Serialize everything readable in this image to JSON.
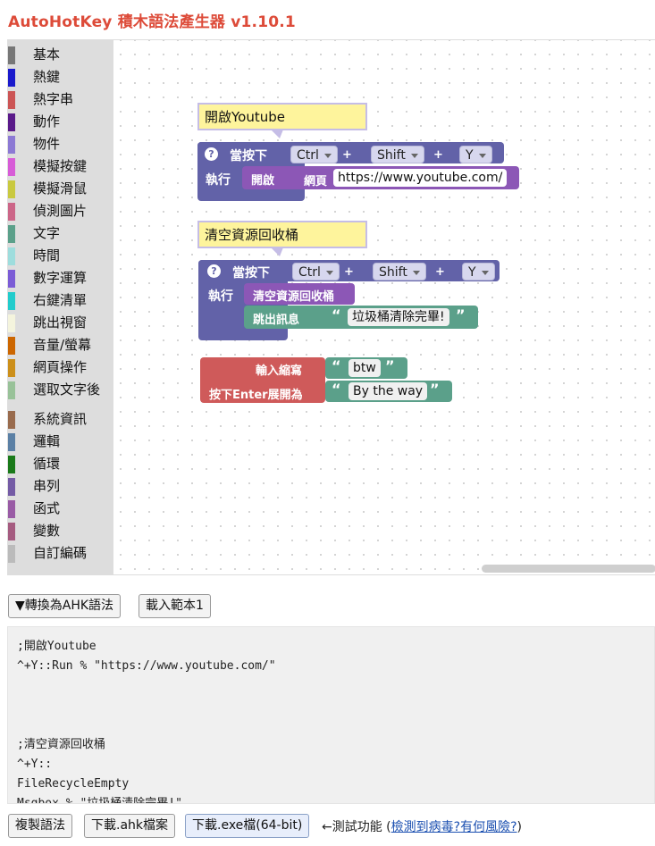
{
  "app": {
    "title": "AutoHotKey 積木語法產生器 v1.10.1"
  },
  "toolbox": {
    "categories": [
      {
        "label": "基本",
        "color": "#777777"
      },
      {
        "label": "熱鍵",
        "color": "#1a1acc"
      },
      {
        "label": "熱字串",
        "color": "#cc5555"
      },
      {
        "label": "動作",
        "color": "#5a1a8a"
      },
      {
        "label": "物件",
        "color": "#8c79d4"
      },
      {
        "label": "模擬按鍵",
        "color": "#d75cd7"
      },
      {
        "label": "模擬滑鼠",
        "color": "#c9c940"
      },
      {
        "label": "偵測圖片",
        "color": "#cc6688"
      },
      {
        "label": "文字",
        "color": "#5ba08a"
      },
      {
        "label": "時間",
        "color": "#9edddd"
      },
      {
        "label": "數字運算",
        "color": "#7b5cd6"
      },
      {
        "label": "右鍵清單",
        "color": "#22cccc"
      },
      {
        "label": "跳出視窗",
        "color": "#f4f4dd"
      },
      {
        "label": "音量/螢幕",
        "color": "#cc6600"
      },
      {
        "label": "網頁操作",
        "color": "#cc8f1a"
      },
      {
        "label": "選取文字後",
        "color": "#99c299"
      },
      {
        "label": "系統資訊",
        "color": "#996b4d"
      },
      {
        "label": "邏輯",
        "color": "#5b80a5"
      },
      {
        "label": "循環",
        "color": "#1a7a1a"
      },
      {
        "label": "串列",
        "color": "#745ba5"
      },
      {
        "label": "函式",
        "color": "#995ba5"
      },
      {
        "label": "變數",
        "color": "#a55b80"
      },
      {
        "label": "自訂編碼",
        "color": "#bbbbbb"
      }
    ]
  },
  "blocks": {
    "hotkey1": {
      "comment": "開啟Youtube",
      "qmark": "?",
      "label": "當按下",
      "mod1": "Ctrl",
      "plus1": "+",
      "mod2": "Shift",
      "plus2": "+",
      "key": "Y",
      "exec_label": "執行",
      "open_label": "開啟",
      "web_label": "網頁",
      "url": "https://www.youtube.com/"
    },
    "hotkey2": {
      "comment": "清空資源回收桶",
      "qmark": "?",
      "label": "當按下",
      "mod1": "Ctrl",
      "plus1": "+",
      "mod2": "Shift",
      "plus2": "+",
      "key": "Y",
      "exec_label": "執行",
      "empty_bin_label": "清空資源回收桶",
      "msg_label": "跳出訊息",
      "msg_text": "垃圾桶清除完畢!"
    },
    "hotstring": {
      "abbr_label": "輸入縮寫",
      "abbr_value": "btw",
      "expand_label": "按下Enter展開為",
      "expand_value": "By the way",
      "open_quote": "“",
      "close_quote": "”"
    }
  },
  "buttons": {
    "convert": "▼轉換為AHK語法",
    "load_example": "載入範本1",
    "copy": "複製語法",
    "download_ahk": "下載.ahk檔案",
    "download_exe": "下載.exe檔(64-bit)"
  },
  "code_output": ";開啟Youtube\n^+Y::Run % \"https://www.youtube.com/\"\n\n\n\n;清空資源回收桶\n^+Y::\nFileRecycleEmpty\nMsgbox % \"垃圾桶清除完畢!\"\nReturn",
  "note": {
    "prefix": "←測試功能 (",
    "link1": "檢測到病毒?",
    "link2": "有何風險?",
    "suffix": ")"
  }
}
